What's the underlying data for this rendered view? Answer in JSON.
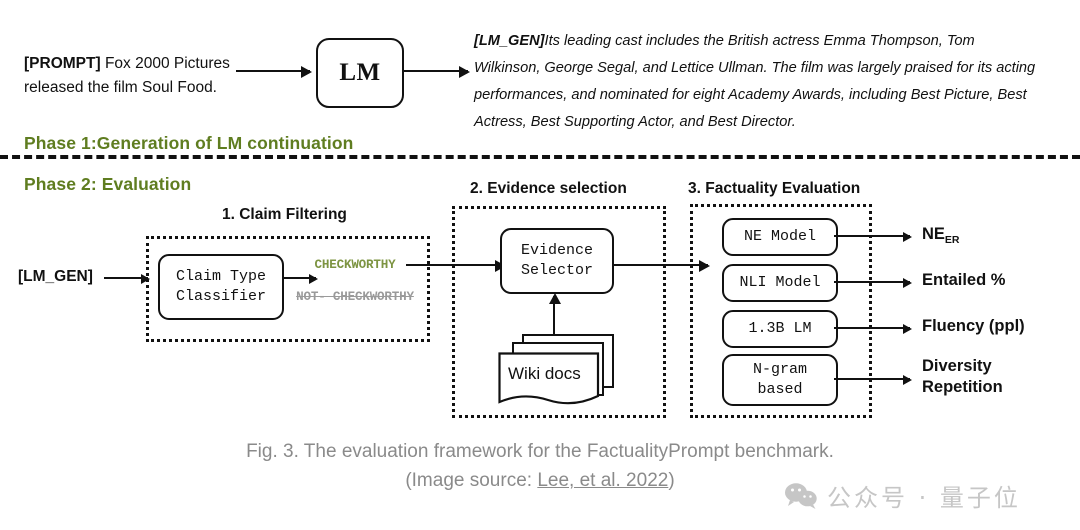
{
  "figure": {
    "phase1": {
      "label": "Phase 1:Generation of LM continuation",
      "prompt_tag": "[PROMPT]",
      "prompt_text": " Fox 2000 Pictures released the film Soul Food.",
      "model_box": "LM",
      "generation_tag": "[LM_GEN]",
      "generation_text": "Its leading cast includes the British actress Emma Thompson, Tom Wilkinson, George Segal, and Lettice Ullman. The film was largely praised for its acting performances, and nominated for eight Academy Awards, including Best Picture, Best Actress, Best Supporting Actor, and Best Director."
    },
    "phase2": {
      "label": "Phase 2: Evaluation",
      "input_tag": "[LM_GEN]",
      "step1": {
        "title": "1. Claim Filtering",
        "classifier": "Claim Type\nClassifier",
        "accepted_label": "CHECKWORTHY",
        "rejected_label": "NOT-\nCHECKWORTHY"
      },
      "step2": {
        "title": "2. Evidence selection",
        "selector": "Evidence\nSelector",
        "docs": "Wiki docs"
      },
      "step3": {
        "title": "3. Factuality Evaluation",
        "rows": [
          {
            "model": "NE Model",
            "metric": "NE",
            "metric_sub": "ER",
            "metric_line2": ""
          },
          {
            "model": "NLI Model",
            "metric": "Entailed %",
            "metric_sub": "",
            "metric_line2": ""
          },
          {
            "model": "1.3B LM",
            "metric": "Fluency (ppl)",
            "metric_sub": "",
            "metric_line2": ""
          },
          {
            "model": "N-gram\nbased",
            "metric": "Diversity",
            "metric_sub": "",
            "metric_line2": "Repetition"
          }
        ]
      }
    }
  },
  "caption": {
    "line1": "Fig. 3. The evaluation framework for the FactualityPrompt benchmark.",
    "line2_prefix": "(Image source: ",
    "line2_link": "Lee, et al. 2022",
    "line2_suffix": ")"
  },
  "watermark": {
    "icon": "wechat-icon",
    "text": "公众号 · 量子位"
  },
  "colors": {
    "phase_green": "#5f7d20",
    "checkworthy_green": "#7d9442",
    "rejected_gray": "#9a9a9a",
    "caption_gray": "#8a8a8a",
    "watermark_gray": "#c6c6c6",
    "stroke": "#111111"
  }
}
